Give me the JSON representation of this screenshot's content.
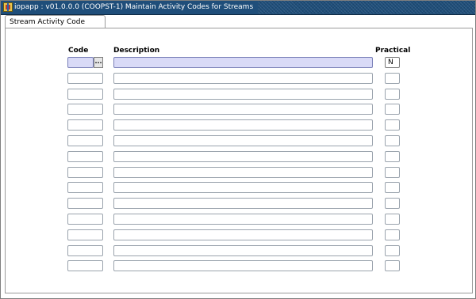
{
  "window": {
    "title": "iopapp : v01.0.0.0 (COOPST-1) Maintain Activity Codes for Streams"
  },
  "tab": {
    "label": "Stream Activity Code"
  },
  "columns": {
    "code": "Code",
    "description": "Description",
    "practical": "Practical"
  },
  "lov_button_label": "...",
  "rows": [
    {
      "code": "",
      "description": "",
      "practical": "N"
    },
    {
      "code": "",
      "description": "",
      "practical": ""
    },
    {
      "code": "",
      "description": "",
      "practical": ""
    },
    {
      "code": "",
      "description": "",
      "practical": ""
    },
    {
      "code": "",
      "description": "",
      "practical": ""
    },
    {
      "code": "",
      "description": "",
      "practical": ""
    },
    {
      "code": "",
      "description": "",
      "practical": ""
    },
    {
      "code": "",
      "description": "",
      "practical": ""
    },
    {
      "code": "",
      "description": "",
      "practical": ""
    },
    {
      "code": "",
      "description": "",
      "practical": ""
    },
    {
      "code": "",
      "description": "",
      "practical": ""
    },
    {
      "code": "",
      "description": "",
      "practical": ""
    },
    {
      "code": "",
      "description": "",
      "practical": ""
    },
    {
      "code": "",
      "description": "",
      "practical": ""
    }
  ],
  "colors": {
    "titlebar": "#1f4e7a",
    "active_field": "#d9daf7"
  }
}
